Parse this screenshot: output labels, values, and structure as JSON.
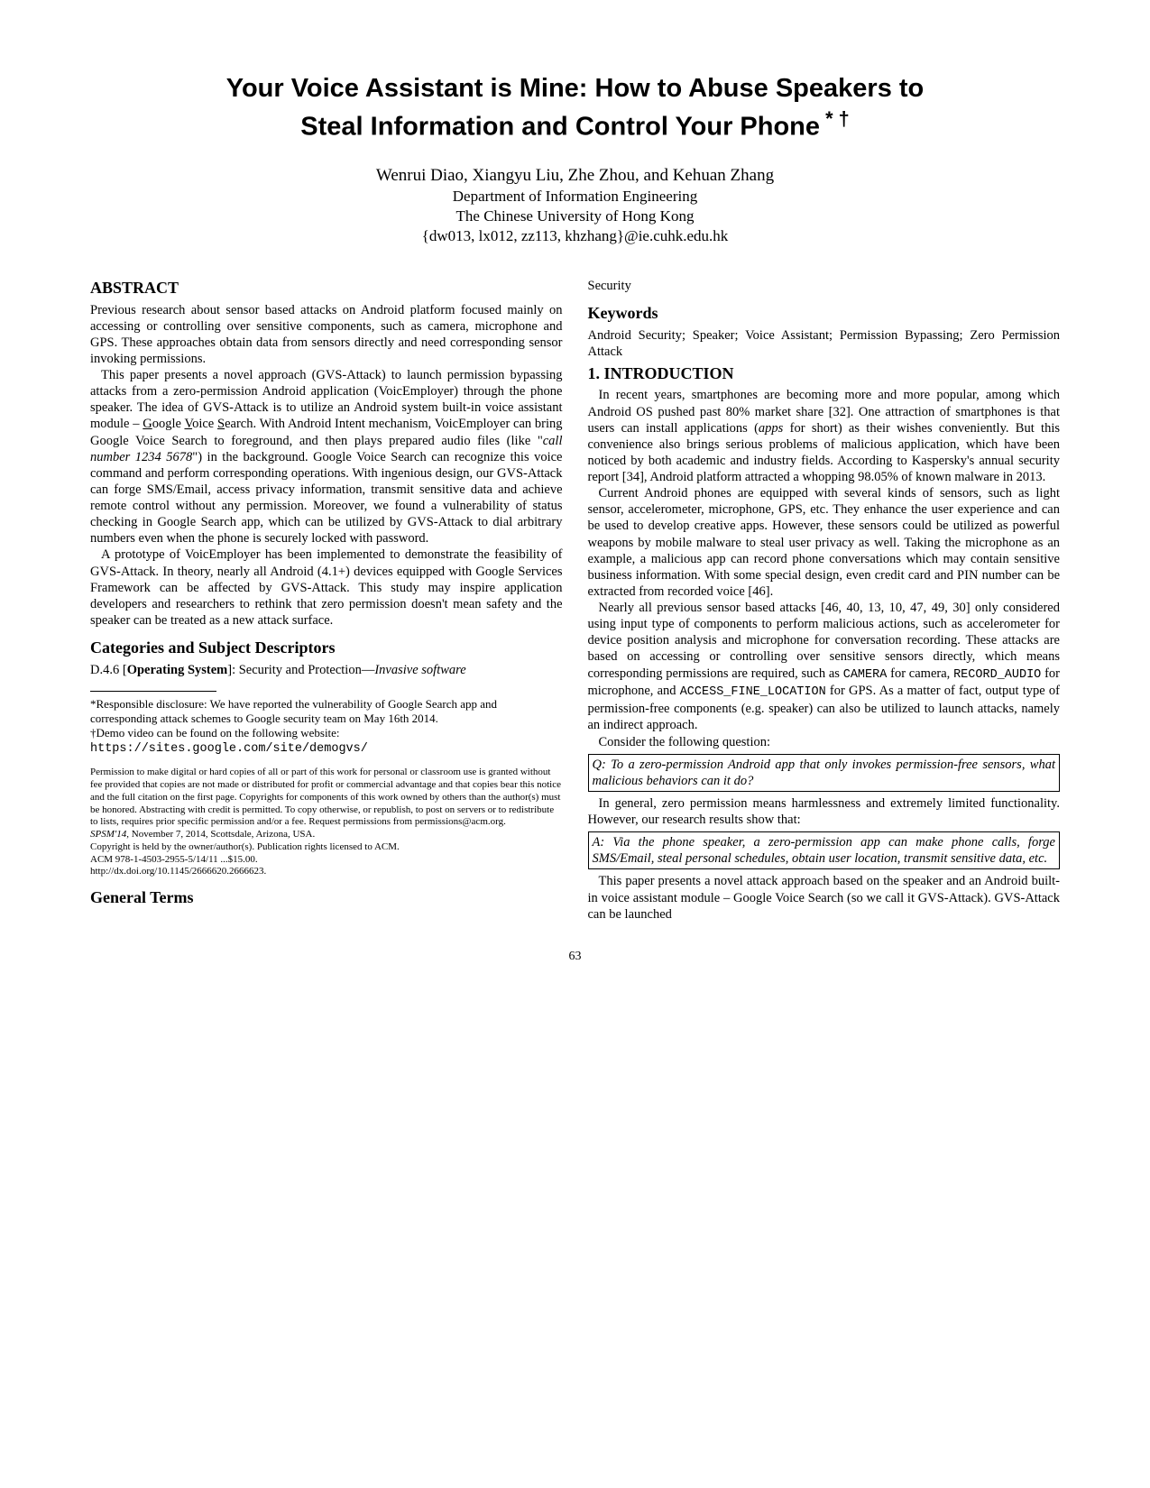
{
  "title_line1": "Your Voice Assistant is Mine: How to Abuse Speakers to",
  "title_line2": "Steal Information and Control Your Phone",
  "title_marks": " * †",
  "authors": "Wenrui Diao, Xiangyu Liu, Zhe Zhou, and Kehuan Zhang",
  "affil1": "Department of Information Engineering",
  "affil2": "The Chinese University of Hong Kong",
  "emails": "{dw013, lx012, zz113, khzhang}@ie.cuhk.edu.hk",
  "abstract_h": "ABSTRACT",
  "abstract_p1": "Previous research about sensor based attacks on Android platform focused mainly on accessing or controlling over sensitive components, such as camera, microphone and GPS. These approaches obtain data from sensors directly and need corresponding sensor invoking permissions.",
  "abstract_p2a": "This paper presents a novel approach (GVS-Attack) to launch permission bypassing attacks from a zero-permission Android application (VoicEmployer) through the phone speaker. The idea of GVS-Attack is to utilize an Android system built-in voice assistant module – ",
  "abstract_p2_g": "G",
  "abstract_p2_oogle": "oogle ",
  "abstract_p2_v": "V",
  "abstract_p2_oice": "oice ",
  "abstract_p2_s": "S",
  "abstract_p2b": "earch. With Android Intent mechanism, VoicEmployer can bring Google Voice Search to foreground, and then plays prepared audio files (like \"",
  "abstract_p2_cmd": "call number 1234 5678",
  "abstract_p2c": "\") in the background. Google Voice Search can recognize this voice command and perform corresponding operations. With ingenious design, our GVS-Attack can forge SMS/Email, access privacy information, transmit sensitive data and achieve remote control without any permission. Moreover, we found a vulnerability of status checking in Google Search app, which can be utilized by GVS-Attack to dial arbitrary numbers even when the phone is securely locked with password.",
  "abstract_p3": "A prototype of VoicEmployer has been implemented to demonstrate the feasibility of GVS-Attack. In theory, nearly all Android (4.1+) devices equipped with Google Services Framework can be affected by GVS-Attack. This study may inspire application developers and researchers to rethink that zero permission doesn't mean safety and the speaker can be treated as a new attack surface.",
  "cats_h": "Categories and Subject Descriptors",
  "cats_p_a": "D.4.6 [",
  "cats_p_b": "Operating System",
  "cats_p_c": "]: Security and Protection—",
  "cats_p_d": "Invasive software",
  "fn_star": "*Responsible disclosure: We have reported the vulnerability of Google Search app and corresponding attack schemes to Google security team on May 16th 2014.",
  "fn_dag_a": "†Demo video can be found on the following website: ",
  "fn_dag_url": "https://sites.google.com/site/demogvs/",
  "perm_p1": "Permission to make digital or hard copies of all or part of this work for personal or classroom use is granted without fee provided that copies are not made or distributed for profit or commercial advantage and that copies bear this notice and the full citation on the first page. Copyrights for components of this work owned by others than the author(s) must be honored. Abstracting with credit is permitted. To copy otherwise, or republish, to post on servers or to redistribute to lists, requires prior specific permission and/or a fee. Request permissions from permissions@acm.org.",
  "perm_p2a": "SPSM'14,",
  "perm_p2b": " November 7, 2014, Scottsdale, Arizona, USA.",
  "perm_p3": "Copyright is held by the owner/author(s). Publication rights licensed to ACM.",
  "perm_p4": "ACM 978-1-4503-2955-5/14/11 ...$15.00.",
  "perm_p5": "http://dx.doi.org/10.1145/2666620.2666623.",
  "gt_h": "General Terms",
  "gt_p": "Security",
  "kw_h": "Keywords",
  "kw_p": "Android Security; Speaker; Voice Assistant; Permission Bypassing; Zero Permission Attack",
  "intro_h": "1.   INTRODUCTION",
  "intro_p1a": "In recent years, smartphones are becoming more and more popular, among which Android OS pushed past 80% market share [32]. One attraction of smartphones is that users can install applications (",
  "intro_p1b": "apps",
  "intro_p1c": " for short) as their wishes conveniently. But this convenience also brings serious problems of malicious application, which have been noticed by both academic and industry fields. According to Kaspersky's annual security report [34], Android platform attracted a whopping 98.05% of known malware in 2013.",
  "intro_p2a": "Current Android phones are equipped with several kinds of sensors, such as light sensor, accelerometer, microphone, GPS, etc. They enhance the user experience and can be used to develop creative apps. However, these sensors could be utilized as powerful weapons by mobile malware to steal user privacy as well. Taking the microphone as an example, a malicious app can record phone conversations which may contain sensitive business information. With some special design, even credit card and PIN number can be extracted from recorded voice [46].",
  "intro_p3a": "Nearly all previous sensor based attacks [46, 40, 13, 10, 47, 49, 30] only considered using input type of components to perform malicious actions, such as accelerometer for device position analysis and microphone for conversation recording. These attacks are based on accessing or controlling over sensitive sensors directly, which means corresponding permissions are required, such as ",
  "intro_p3_cam": "CAMERA",
  "intro_p3b": " for camera, ",
  "intro_p3_rec": "RECORD_AUDIO",
  "intro_p3c": " for microphone, and ",
  "intro_p3_loc": "ACCESS_FINE_LOCATION",
  "intro_p3d": " for GPS. As a matter of fact, output type of permission-free components (e.g. speaker) can also be utilized to launch attacks, namely an indirect approach.",
  "intro_p4": "Consider the following question:",
  "box_q": "Q: To a zero-permission Android app that only invokes permission-free sensors, what malicious behaviors can it do?",
  "intro_p5": "In general, zero permission means harmlessness and extremely limited functionality. However, our research results show that:",
  "box_a": "A: Via the phone speaker, a zero-permission app can make phone calls, forge SMS/Email, steal personal schedules, obtain user location, transmit sensitive data, etc.",
  "intro_p6": "This paper presents a novel attack approach based on the speaker and an Android built-in voice assistant module – Google Voice Search (so we call it GVS-Attack). GVS-Attack can be launched",
  "pagenum": "63"
}
